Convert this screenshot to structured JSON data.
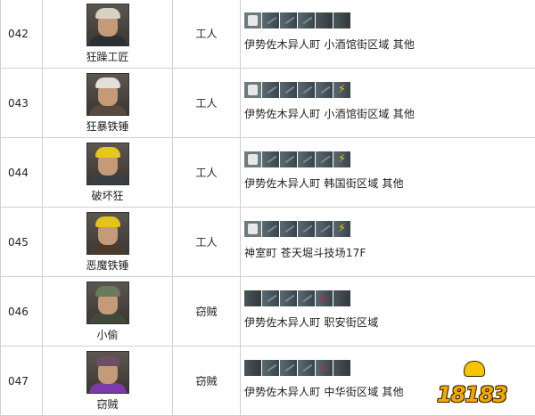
{
  "rows": [
    {
      "id": "042",
      "name": "狂躁工匠",
      "type": "工人",
      "stats": [
        "fist",
        "dim",
        "dim",
        "dim",
        "off",
        "off"
      ],
      "location": "伊势佐木异人町 小酒馆街区域 其他",
      "hat": "#d8d2c4",
      "shirt": "#2c2f33"
    },
    {
      "id": "043",
      "name": "狂暴铁锤",
      "type": "工人",
      "stats": [
        "fist",
        "dim",
        "dim",
        "dim",
        "dim",
        "bolt"
      ],
      "location": "伊势佐木异人町 小酒馆街区域 其他",
      "hat": "#e2e0d8",
      "shirt": "#5a4a3e"
    },
    {
      "id": "044",
      "name": "破坏狂",
      "type": "工人",
      "stats": [
        "fist",
        "dim",
        "dim",
        "dim",
        "dim",
        "bolt"
      ],
      "location": "伊势佐木异人町 韩国街区域 其他",
      "hat": "#e7c71c",
      "shirt": "#3a3f45"
    },
    {
      "id": "045",
      "name": "恶魔铁锤",
      "type": "工人",
      "stats": [
        "fist",
        "dim",
        "dim",
        "dim",
        "dim",
        "bolt"
      ],
      "location": "神室町 苍天堀斗技场17F",
      "hat": "#e3c21a",
      "shirt": "#4a3b2c"
    },
    {
      "id": "046",
      "name": "小偷",
      "type": "窃贼",
      "stats": [
        "off",
        "dim",
        "dim",
        "dim",
        "fire",
        "off"
      ],
      "location": "伊势佐木异人町 职安街区域",
      "hat": "#6a7a5a",
      "shirt": "#3f4a3a"
    },
    {
      "id": "047",
      "name": "窃贼",
      "type": "窃贼",
      "stats": [
        "off",
        "dim",
        "dim",
        "dim",
        "fire",
        "off"
      ],
      "location": "伊势佐木异人町 中华街区域 其他",
      "hat": "#6a5060",
      "shirt": "#7a3aa8"
    }
  ],
  "icons": {
    "fist": "fist-icon",
    "bolt": "lightning-icon",
    "fire": "fire-icon"
  },
  "watermark": "18183"
}
